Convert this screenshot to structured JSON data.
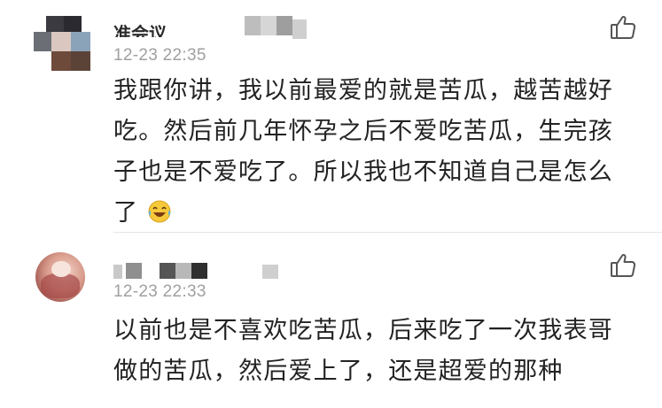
{
  "comments": [
    {
      "username_visible": "准会议",
      "timestamp": "12-23 22:35",
      "lines": [
        "我跟你讲，我以前最爱的就是苦瓜，越苦越好",
        "吃。然后前几年怀孕之后不爱吃苦瓜，生完孩",
        "子也是不爱吃了。所以我也不知道自己是怎么",
        "了"
      ],
      "emoji": "laugh-cry-emoji",
      "like_icon": "thumbs-up-icon"
    },
    {
      "timestamp": "12-23 22:33",
      "lines": [
        "以前也是不喜欢吃苦瓜，后来吃了一次我表哥",
        "做的苦瓜，然后爱上了，还是超爱的那种"
      ],
      "like_icon": "thumbs-up-icon"
    }
  ],
  "colors": {
    "text": "#222222",
    "timestamp": "#a0a0a0",
    "divider": "#e6e6e6",
    "icon": "#555555"
  }
}
